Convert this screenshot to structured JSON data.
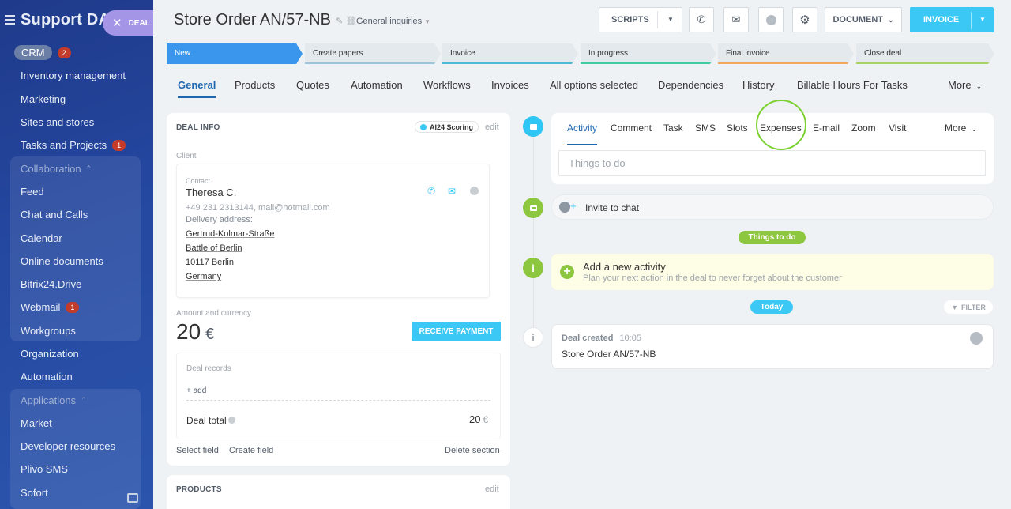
{
  "sidebar": {
    "title": "Support DA",
    "deal_tag": "DEAL",
    "crm": {
      "label": "CRM",
      "badge": "2"
    },
    "items_top": [
      "Inventory management",
      "Marketing",
      "Sites and stores"
    ],
    "tasks": {
      "label": "Tasks and Projects",
      "badge": "1"
    },
    "collab_title": "Collaboration",
    "collab_items": [
      "Feed",
      "Chat and Calls",
      "Calendar",
      "Online documents",
      "Bitrix24.Drive"
    ],
    "webmail": {
      "label": "Webmail",
      "badge": "1"
    },
    "workgroups": "Workgroups",
    "org": "Organization",
    "automation": "Automation",
    "apps_title": "Applications",
    "apps_items": [
      "Market",
      "Developer resources",
      "Plivo SMS",
      "Sofort"
    ]
  },
  "header": {
    "title": "Store Order AN/57-NB",
    "category": "General inquiries",
    "scripts": "SCRIPTS",
    "document": "DOCUMENT",
    "invoice": "INVOICE"
  },
  "stages": [
    "New",
    "Create papers",
    "Invoice",
    "In progress",
    "Final invoice",
    "Close deal"
  ],
  "stage_colors": [
    "#3996ec",
    "#9bc4dd",
    "#4fb8d6",
    "#41cba5",
    "#f5a85c",
    "#a7d365"
  ],
  "tabs": [
    "General",
    "Products",
    "Quotes",
    "Automation",
    "Workflows",
    "Invoices",
    "All options selected",
    "Dependencies",
    "History",
    "Billable Hours For Tasks",
    "More"
  ],
  "deal_info": {
    "title": "DEAL INFO",
    "ai_badge": "AI24 Scoring",
    "edit": "edit",
    "client_label": "Client",
    "contact_label": "Contact",
    "contact_name": "Theresa C.",
    "contact_line": "+49 231 2313144, mail@hotmail.com",
    "delivery_label": "Delivery address:",
    "address": [
      "Gertrud-Kolmar-Straße",
      "Battle of Berlin",
      "10117 Berlin",
      "Germany"
    ],
    "amount_label": "Amount and currency",
    "amount": "20",
    "currency": "€",
    "receive_payment": "RECEIVE PAYMENT",
    "records_label": "Deal records",
    "add_record": "+ add",
    "total_label": "Deal total",
    "total_value": "20",
    "select_field": "Select field",
    "create_field": "Create field",
    "delete_section": "Delete section"
  },
  "products": {
    "title": "PRODUCTS",
    "edit": "edit"
  },
  "activity": {
    "tabs": [
      "Activity",
      "Comment",
      "Task",
      "SMS",
      "Slots",
      "Expenses",
      "E-mail",
      "Zoom",
      "Visit",
      "More"
    ],
    "placeholder": "Things to do",
    "invite": "Invite to chat",
    "things_to_do": "Things to do",
    "add_title": "Add a new activity",
    "add_sub": "Plan your next action in the deal to never forget about the customer",
    "today": "Today",
    "filter": "FILTER",
    "created_title": "Deal created",
    "created_time": "10:05",
    "created_name": "Store Order AN/57-NB"
  },
  "colors": {
    "accent": "#2067b0",
    "primary_button": "#3bc8f5",
    "timeline_green": "#8dc63f",
    "highlight": "#7bd12f"
  }
}
